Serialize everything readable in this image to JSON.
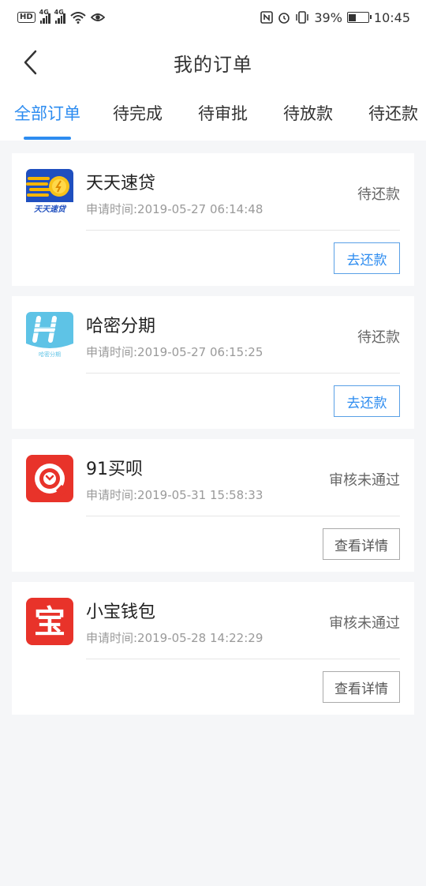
{
  "status_bar": {
    "left_badge": "HD",
    "sig1": "4G",
    "sig2": "4G",
    "battery": "39%",
    "time": "10:45",
    "icons": [
      "nfc-icon",
      "alarm-icon",
      "vibrate-icon",
      "wifi-icon",
      "eye-icon"
    ]
  },
  "header": {
    "title": "我的订单"
  },
  "tabs": [
    {
      "label": "全部订单",
      "active": true
    },
    {
      "label": "待完成"
    },
    {
      "label": "待审批"
    },
    {
      "label": "待放款"
    },
    {
      "label": "待还款"
    }
  ],
  "orders": [
    {
      "name": "天天速贷",
      "time": "申请时间:2019-05-27 06:14:48",
      "status": "待还款",
      "action": "去还款",
      "logo": "tiantian-sudai-logo",
      "logo_text": "天天速贷"
    },
    {
      "name": "哈密分期",
      "time": "申请时间:2019-05-27 06:15:25",
      "status": "待还款",
      "action": "去还款",
      "logo": "hami-fenqi-logo",
      "logo_text": "哈密分期"
    },
    {
      "name": "91买呗",
      "time": "申请时间:2019-05-31 15:58:33",
      "status": "审核未通过",
      "action": "查看详情",
      "logo": "91-maibei-logo"
    },
    {
      "name": "小宝钱包",
      "time": "申请时间:2019-05-28 14:22:29",
      "status": "审核未通过",
      "action": "查看详情",
      "logo": "xiaobao-qianbao-logo",
      "logo_text": "宝"
    }
  ],
  "colors": {
    "accent": "#2d8cf0",
    "background": "#f5f6f8",
    "logo_red": "#e8332a"
  }
}
